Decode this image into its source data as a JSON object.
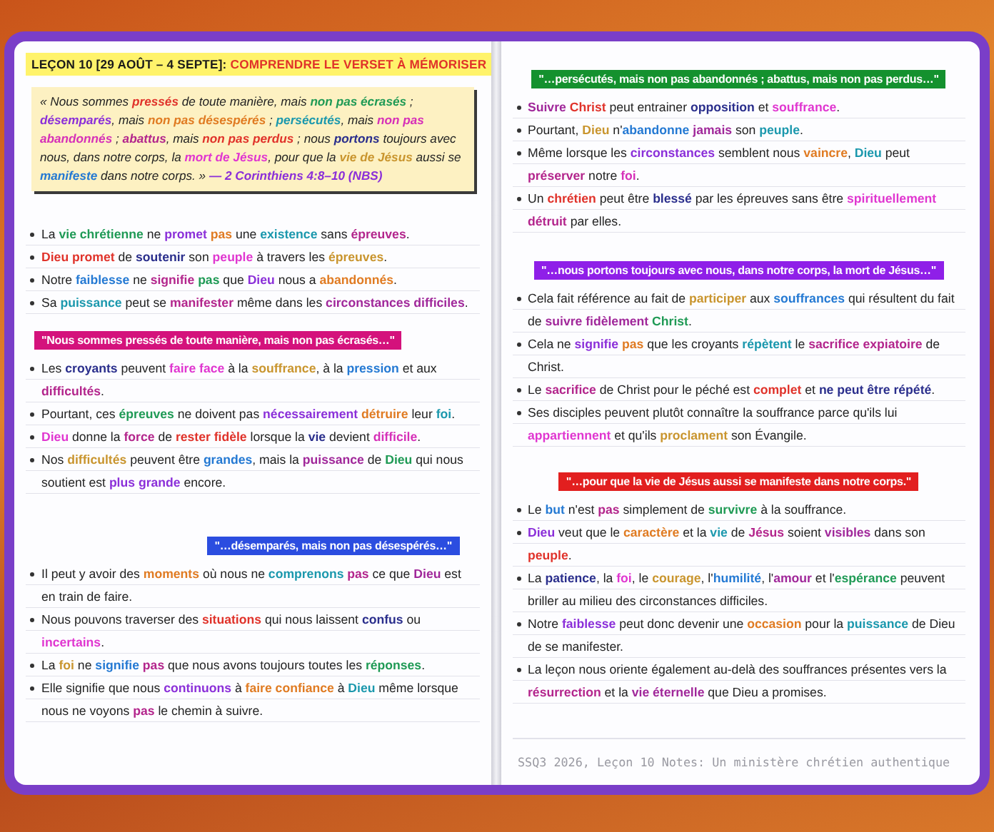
{
  "left_page": {
    "title": [
      {
        "text": "LEÇON 10 [29 AOÛT – 4 SEPTE]: "
      },
      {
        "text": "COMPRENDRE LE VERSET À MÉMORISER",
        "color": "#e0322a"
      }
    ],
    "verse": [
      {
        "text": "« Nous sommes "
      },
      {
        "text": "pressés",
        "color": "#e0322a"
      },
      {
        "text": " de toute manière, mais "
      },
      {
        "text": "non pas écrasés",
        "color": "#1f9a55"
      },
      {
        "text": " ; "
      },
      {
        "text": "désemparés",
        "color": "#8b2fd9"
      },
      {
        "text": ", mais "
      },
      {
        "text": "non pas désespérés",
        "color": "#e07b22"
      },
      {
        "text": " ; "
      },
      {
        "text": "persécutés",
        "color": "#1b98ad"
      },
      {
        "text": ", mais "
      },
      {
        "text": "non pas abandonnés",
        "color": "#d630b8"
      },
      {
        "text": " ; "
      },
      {
        "text": "abattus",
        "color": "#b3258c"
      },
      {
        "text": ", mais "
      },
      {
        "text": "non pas perdus",
        "color": "#e0322a"
      },
      {
        "text": " ; nous "
      },
      {
        "text": "portons",
        "color": "#2a2e8c"
      },
      {
        "text": " toujours avec nous, dans notre corps, la "
      },
      {
        "text": "mort de Jésus",
        "color": "#e036d0"
      },
      {
        "text": ", pour que la "
      },
      {
        "text": "vie de Jésus",
        "color": "#c9952e"
      },
      {
        "text": " aussi se "
      },
      {
        "text": "manifeste",
        "color": "#2479d3"
      },
      {
        "text": " dans notre corps. » "
      },
      {
        "text": "— 2 Corinthiens 4:8–10 (NBS)",
        "color": "#8b2fd9"
      }
    ],
    "bullets": [
      [
        {
          "text": "La "
        },
        {
          "text": "vie chrétienne",
          "color": "#1f9a55"
        },
        {
          "text": " ne "
        },
        {
          "text": "promet ",
          "color": "#8b2fd9"
        },
        {
          "text": "pas",
          "color": "#e07b22"
        },
        {
          "text": " une "
        },
        {
          "text": "existence",
          "color": "#1b98ad"
        },
        {
          "text": " sans "
        },
        {
          "text": "épreuves",
          "color": "#b3258c"
        },
        {
          "text": "."
        }
      ],
      [
        {
          "text": "Dieu promet",
          "color": "#e0322a"
        },
        {
          "text": " de "
        },
        {
          "text": "soutenir",
          "color": "#2a2e8c"
        },
        {
          "text": " son "
        },
        {
          "text": "peuple",
          "color": "#e036d0"
        },
        {
          "text": " à travers les "
        },
        {
          "text": "épreuves",
          "color": "#c9952e"
        },
        {
          "text": "."
        }
      ],
      [
        {
          "text": "Notre "
        },
        {
          "text": "faiblesse",
          "color": "#2479d3"
        },
        {
          "text": " ne "
        },
        {
          "text": "signifie ",
          "color": "#b3258c"
        },
        {
          "text": "pas",
          "color": "#1f9a55"
        },
        {
          "text": " que "
        },
        {
          "text": "Dieu",
          "color": "#8b2fd9"
        },
        {
          "text": " nous a "
        },
        {
          "text": "abandonnés",
          "color": "#e07b22"
        },
        {
          "text": "."
        }
      ],
      [
        {
          "text": "Sa "
        },
        {
          "text": "puissance",
          "color": "#1b98ad"
        },
        {
          "text": " peut se "
        },
        {
          "text": "manifester",
          "color": "#b3258c"
        },
        {
          "text": " même dans les "
        },
        {
          "text": "circonstances difficiles",
          "color": "#a0279a"
        },
        {
          "text": "."
        }
      ]
    ],
    "sections": [
      {
        "heading": {
          "text": "\"Nous sommes pressés de toute manière, mais non pas écrasés…\"",
          "color": "#d4127c"
        },
        "bullets": [
          [
            {
              "text": "Les "
            },
            {
              "text": "croyants",
              "color": "#2a2e8c"
            },
            {
              "text": " peuvent "
            },
            {
              "text": "faire face",
              "color": "#e036d0"
            },
            {
              "text": " à la "
            },
            {
              "text": "souffrance",
              "color": "#c9952e"
            },
            {
              "text": ", à la "
            },
            {
              "text": "pression",
              "color": "#2479d3"
            },
            {
              "text": " et aux "
            },
            {
              "text": "difficultés",
              "color": "#b3258c"
            },
            {
              "text": "."
            }
          ],
          [
            {
              "text": "Pourtant, ces "
            },
            {
              "text": "épreuves",
              "color": "#1f9a55"
            },
            {
              "text": " ne doivent pas "
            },
            {
              "text": "nécessairement ",
              "color": "#8b2fd9"
            },
            {
              "text": "détruire",
              "color": "#e07b22"
            },
            {
              "text": " leur "
            },
            {
              "text": "foi",
              "color": "#1b98ad"
            },
            {
              "text": "."
            }
          ],
          [
            {
              "text": "Dieu",
              "color": "#e036d0"
            },
            {
              "text": " donne la "
            },
            {
              "text": "force",
              "color": "#b3258c"
            },
            {
              "text": " de "
            },
            {
              "text": "rester fidèle",
              "color": "#e0322a"
            },
            {
              "text": " lorsque la "
            },
            {
              "text": "vie",
              "color": "#2a2e8c"
            },
            {
              "text": " devient "
            },
            {
              "text": "difficile",
              "color": "#d630b8"
            },
            {
              "text": "."
            }
          ],
          [
            {
              "text": "Nos "
            },
            {
              "text": "difficultés",
              "color": "#c9952e"
            },
            {
              "text": " peuvent être "
            },
            {
              "text": "grandes",
              "color": "#2479d3"
            },
            {
              "text": ", mais la "
            },
            {
              "text": "puissance",
              "color": "#a0279a"
            },
            {
              "text": " de "
            },
            {
              "text": "Dieu",
              "color": "#1f9a55"
            },
            {
              "text": " qui nous soutient est "
            },
            {
              "text": "plus grande",
              "color": "#8b2fd9"
            },
            {
              "text": " encore."
            }
          ]
        ]
      },
      {
        "heading": {
          "text": "\"…désemparés, mais non pas désespérés…\"",
          "color": "#2b4de0"
        },
        "bullets": [
          [
            {
              "text": "Il peut y avoir des "
            },
            {
              "text": "moments",
              "color": "#e07b22"
            },
            {
              "text": " où nous ne "
            },
            {
              "text": "comprenons ",
              "color": "#1b98ad"
            },
            {
              "text": "pas",
              "color": "#b3258c"
            },
            {
              "text": " ce que "
            },
            {
              "text": "Dieu",
              "color": "#a0279a"
            },
            {
              "text": " est en train de faire."
            }
          ],
          [
            {
              "text": "Nous pouvons traverser des "
            },
            {
              "text": "situations",
              "color": "#e0322a"
            },
            {
              "text": " qui nous laissent "
            },
            {
              "text": "confus",
              "color": "#2a2e8c"
            },
            {
              "text": " ou "
            },
            {
              "text": "incertains",
              "color": "#e036d0"
            },
            {
              "text": "."
            }
          ],
          [
            {
              "text": "La "
            },
            {
              "text": "foi",
              "color": "#c9952e"
            },
            {
              "text": " ne "
            },
            {
              "text": "signifie ",
              "color": "#2479d3"
            },
            {
              "text": "pas",
              "color": "#b3258c"
            },
            {
              "text": " que nous avons toujours toutes les "
            },
            {
              "text": "réponses",
              "color": "#1f9a55"
            },
            {
              "text": "."
            }
          ],
          [
            {
              "text": "Elle signifie que nous "
            },
            {
              "text": "continuons",
              "color": "#8b2fd9"
            },
            {
              "text": " à "
            },
            {
              "text": "faire confiance",
              "color": "#e07b22"
            },
            {
              "text": " à "
            },
            {
              "text": "Dieu",
              "color": "#1b98ad"
            },
            {
              "text": " même lorsque nous ne voyons "
            },
            {
              "text": "pas",
              "color": "#b3258c"
            },
            {
              "text": " le chemin à suivre."
            }
          ]
        ]
      }
    ]
  },
  "right_page": {
    "sections": [
      {
        "heading": {
          "text": "\"…persécutés, mais non pas abandonnés ; abattus, mais non pas perdus…\"",
          "color": "#14912e"
        },
        "bullets": [
          [
            {
              "text": "Suivre ",
              "color": "#a0279a"
            },
            {
              "text": "Christ",
              "color": "#e0322a"
            },
            {
              "text": " peut entrainer "
            },
            {
              "text": "opposition",
              "color": "#2a2e8c"
            },
            {
              "text": " et "
            },
            {
              "text": "souffrance",
              "color": "#e036d0"
            },
            {
              "text": "."
            }
          ],
          [
            {
              "text": "Pourtant, "
            },
            {
              "text": "Dieu",
              "color": "#c9952e"
            },
            {
              "text": " n'"
            },
            {
              "text": "abandonne ",
              "color": "#2479d3"
            },
            {
              "text": "jamais",
              "color": "#a0279a"
            },
            {
              "text": " son "
            },
            {
              "text": "peuple",
              "color": "#1b98ad"
            },
            {
              "text": "."
            }
          ],
          [
            {
              "text": "Même lorsque les "
            },
            {
              "text": "circonstances",
              "color": "#8b2fd9"
            },
            {
              "text": " semblent nous "
            },
            {
              "text": "vaincre",
              "color": "#e07b22"
            },
            {
              "text": ", "
            },
            {
              "text": "Dieu",
              "color": "#1b98ad"
            },
            {
              "text": " peut "
            },
            {
              "text": "préserver",
              "color": "#b3258c"
            },
            {
              "text": " notre "
            },
            {
              "text": "foi",
              "color": "#d630b8"
            },
            {
              "text": "."
            }
          ],
          [
            {
              "text": "Un "
            },
            {
              "text": "chrétien",
              "color": "#e0322a"
            },
            {
              "text": " peut être "
            },
            {
              "text": "blessé",
              "color": "#2a2e8c"
            },
            {
              "text": " par les épreuves sans être "
            },
            {
              "text": "spirituellement ",
              "color": "#e036d0"
            },
            {
              "text": "détruit",
              "color": "#b3258c"
            },
            {
              "text": " par elles."
            }
          ]
        ]
      },
      {
        "heading": {
          "text": "\"…nous portons toujours avec nous, dans notre corps, la mort de Jésus…\"",
          "color": "#8f1fe8"
        },
        "bullets": [
          [
            {
              "text": "Cela fait référence au fait de "
            },
            {
              "text": "participer",
              "color": "#c9952e"
            },
            {
              "text": " aux "
            },
            {
              "text": "souffrances",
              "color": "#2479d3"
            },
            {
              "text": " qui résultent du fait de "
            },
            {
              "text": "suivre fidèlement ",
              "color": "#a0279a"
            },
            {
              "text": "Christ",
              "color": "#1f9a55"
            },
            {
              "text": "."
            }
          ],
          [
            {
              "text": "Cela ne "
            },
            {
              "text": "signifie ",
              "color": "#8b2fd9"
            },
            {
              "text": "pas",
              "color": "#e07b22"
            },
            {
              "text": " que les croyants "
            },
            {
              "text": "répètent",
              "color": "#1b98ad"
            },
            {
              "text": " le "
            },
            {
              "text": "sacrifice expiatoire",
              "color": "#b3258c"
            },
            {
              "text": " de Christ."
            }
          ],
          [
            {
              "text": "Le "
            },
            {
              "text": "sacrifice",
              "color": "#b3258c"
            },
            {
              "text": " de Christ pour le péché est "
            },
            {
              "text": "complet",
              "color": "#e0322a"
            },
            {
              "text": " et "
            },
            {
              "text": "ne peut être répété",
              "color": "#2a2e8c"
            },
            {
              "text": "."
            }
          ],
          [
            {
              "text": "Ses disciples peuvent plutôt connaître la souffrance parce qu'ils lui "
            },
            {
              "text": "appartiennent",
              "color": "#e036d0"
            },
            {
              "text": " et qu'ils "
            },
            {
              "text": "proclament",
              "color": "#c9952e"
            },
            {
              "text": " son Évangile."
            }
          ]
        ]
      },
      {
        "heading": {
          "text": "\"…pour que la vie de Jésus aussi se manifeste dans notre corps.\"",
          "color": "#e21f1f"
        },
        "bullets": [
          [
            {
              "text": "Le "
            },
            {
              "text": "but",
              "color": "#2479d3"
            },
            {
              "text": " n'est "
            },
            {
              "text": "pas",
              "color": "#b3258c"
            },
            {
              "text": " simplement de "
            },
            {
              "text": "survivre",
              "color": "#1f9a55"
            },
            {
              "text": " à la souffrance."
            }
          ],
          [
            {
              "text": "Dieu",
              "color": "#8b2fd9"
            },
            {
              "text": " veut que le "
            },
            {
              "text": "caractère",
              "color": "#e07b22"
            },
            {
              "text": " et la "
            },
            {
              "text": "vie",
              "color": "#1b98ad"
            },
            {
              "text": " de "
            },
            {
              "text": "Jésus",
              "color": "#b3258c"
            },
            {
              "text": " soient "
            },
            {
              "text": "visibles",
              "color": "#a0279a"
            },
            {
              "text": " dans son "
            },
            {
              "text": "peuple",
              "color": "#e0322a"
            },
            {
              "text": "."
            }
          ],
          [
            {
              "text": "La "
            },
            {
              "text": "patience",
              "color": "#2a2e8c"
            },
            {
              "text": ", la "
            },
            {
              "text": "foi",
              "color": "#e036d0"
            },
            {
              "text": ", le "
            },
            {
              "text": "courage",
              "color": "#c9952e"
            },
            {
              "text": ", l'"
            },
            {
              "text": "humilité",
              "color": "#2479d3"
            },
            {
              "text": ", l'"
            },
            {
              "text": "amour",
              "color": "#a0279a"
            },
            {
              "text": " et l'"
            },
            {
              "text": "espérance",
              "color": "#1f9a55"
            },
            {
              "text": " peuvent briller au milieu des circonstances difficiles."
            }
          ],
          [
            {
              "text": "Notre "
            },
            {
              "text": "faiblesse",
              "color": "#8b2fd9"
            },
            {
              "text": " peut donc devenir une "
            },
            {
              "text": "occasion",
              "color": "#e07b22"
            },
            {
              "text": " pour la "
            },
            {
              "text": "puissance",
              "color": "#1b98ad"
            },
            {
              "text": " de Dieu de se manifester."
            }
          ],
          [
            {
              "text": "La leçon nous oriente également au-delà des souffrances présentes vers la "
            },
            {
              "text": "résurrection",
              "color": "#b3258c"
            },
            {
              "text": " et la "
            },
            {
              "text": "vie éternelle",
              "color": "#a0279a"
            },
            {
              "text": " que Dieu a promises."
            }
          ]
        ]
      }
    ],
    "footer": "SSQ3 2026, Leçon 10 Notes: Un ministère chrétien authentique"
  }
}
